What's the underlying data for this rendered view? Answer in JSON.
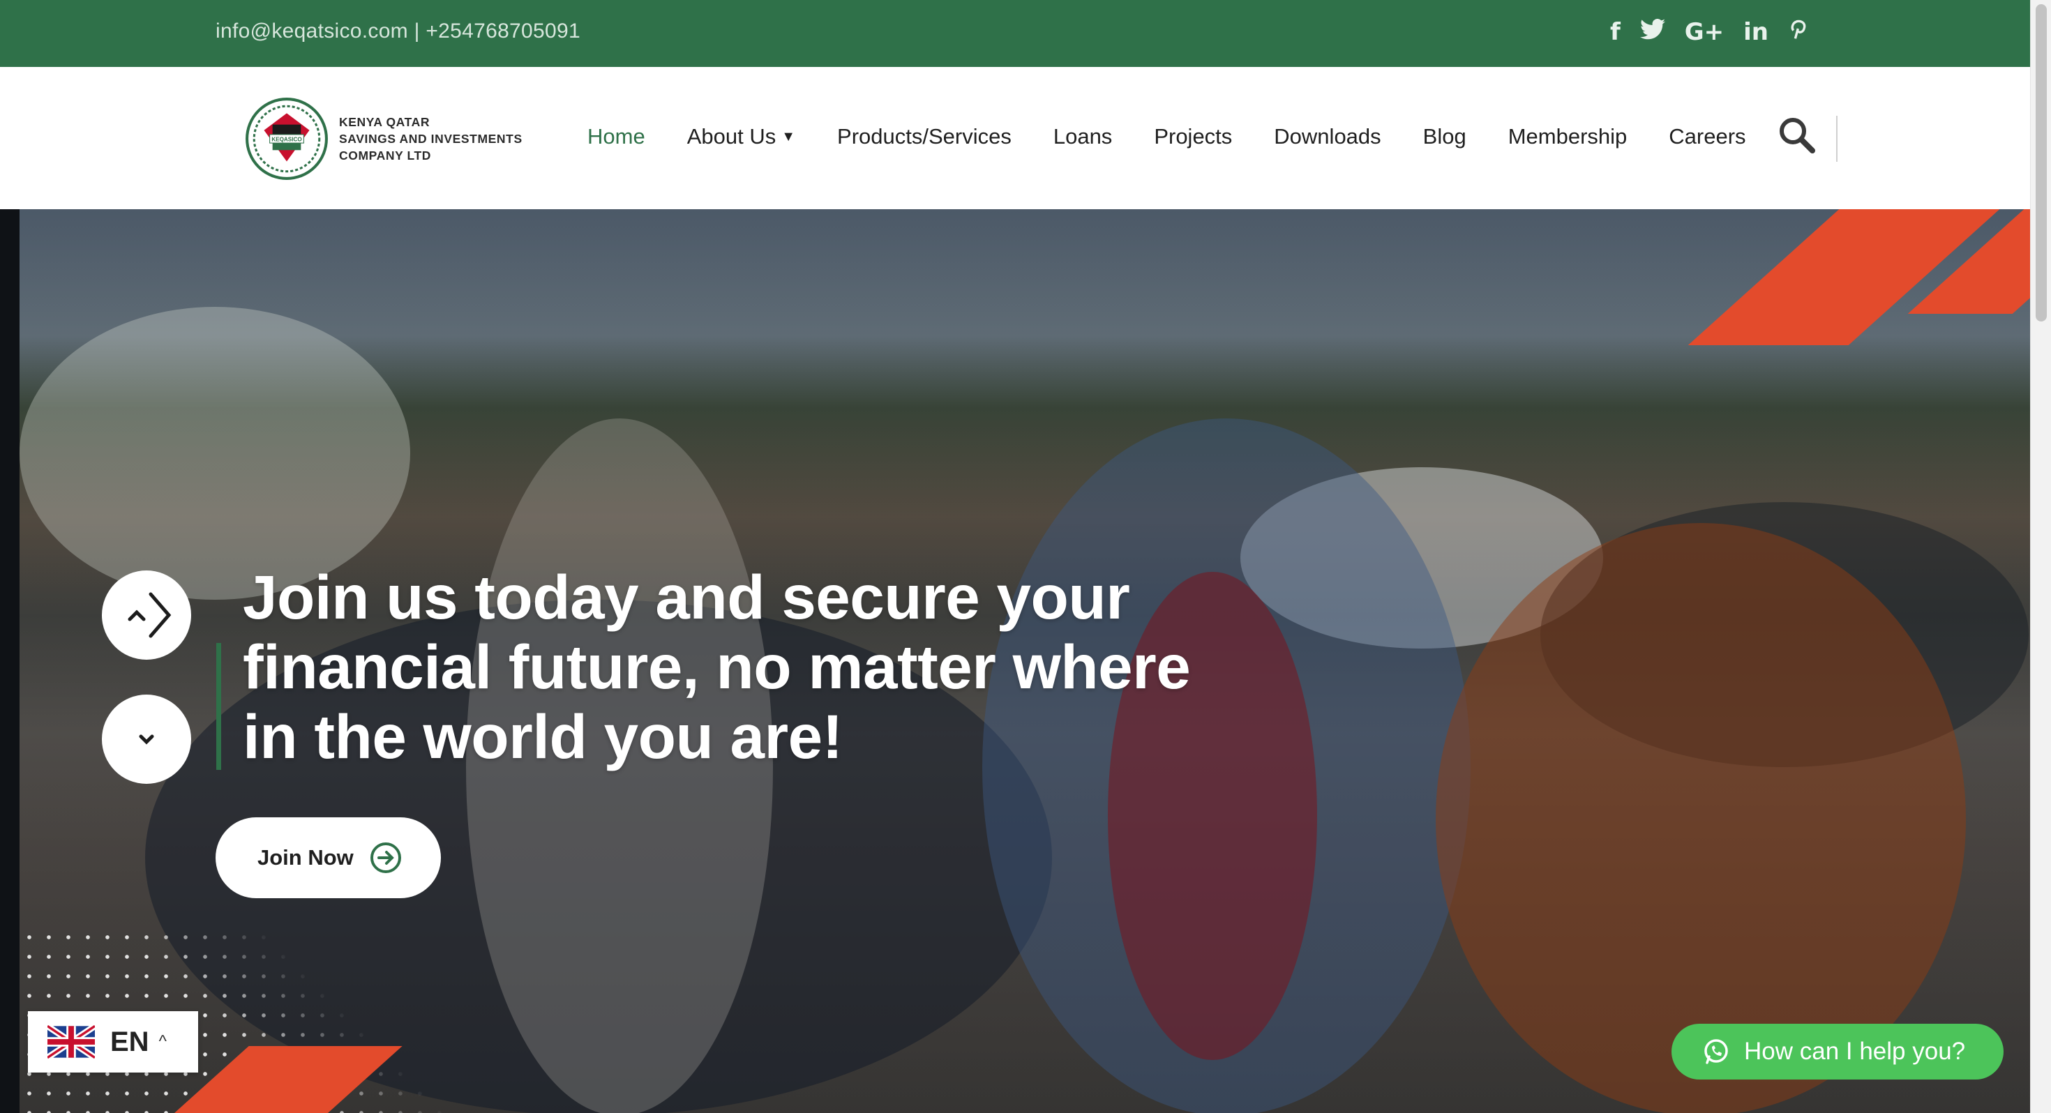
{
  "topbar": {
    "contact": "info@keqatsico.com | +254768705091",
    "socials": [
      {
        "icon": "facebook-icon",
        "glyph": "f"
      },
      {
        "icon": "twitter-icon",
        "glyph": "🐦"
      },
      {
        "icon": "google-plus-icon",
        "glyph": "G+"
      },
      {
        "icon": "linkedin-icon",
        "glyph": "in"
      },
      {
        "icon": "pinterest-icon",
        "glyph": "P"
      }
    ]
  },
  "logo": {
    "badge_text": "KEQASICO",
    "line1": "KENYA QATAR",
    "line2": "SAVINGS AND INVESTMENTS",
    "line3": "COMPANY LTD"
  },
  "nav": {
    "home": "Home",
    "about": "About Us",
    "products": "Products/Services",
    "loans": "Loans",
    "projects": "Projects",
    "downloads": "Downloads",
    "blog": "Blog",
    "membership": "Membership",
    "careers": "Careers"
  },
  "hero": {
    "headline": "Join us today and secure your financial future, no matter where in the world you are!",
    "cta_label": "Join Now"
  },
  "language": {
    "code": "EN",
    "caret": "^"
  },
  "whatsapp": {
    "label": "How can I help you?"
  },
  "colors": {
    "brand_green": "#2f7149",
    "accent_orange": "#e34b2c",
    "whatsapp_green": "#4cc45a"
  }
}
